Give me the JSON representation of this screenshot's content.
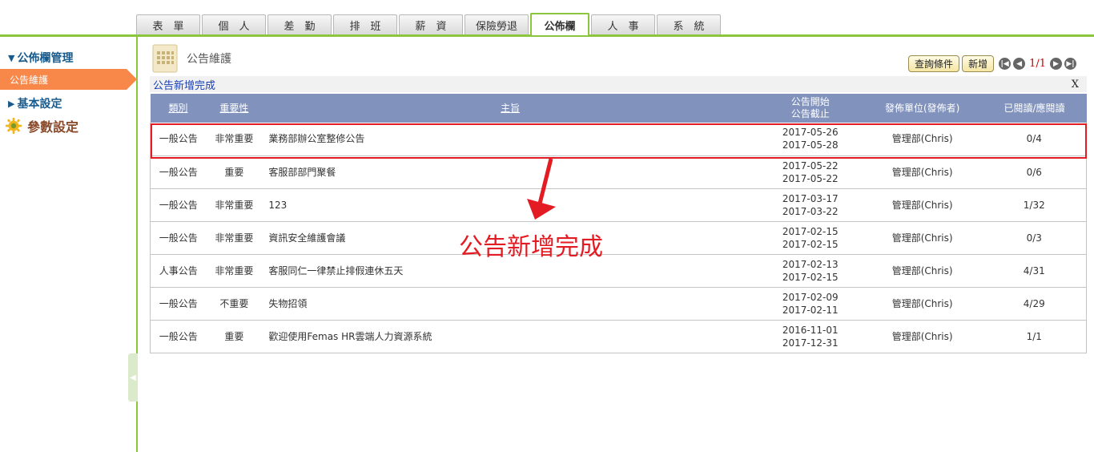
{
  "tabs": [
    {
      "label": "表　單",
      "width": 80
    },
    {
      "label": "個　人",
      "width": 80
    },
    {
      "label": "差　勤",
      "width": 80
    },
    {
      "label": "排　班",
      "width": 80
    },
    {
      "label": "薪　資",
      "width": 80
    },
    {
      "label": "保險勞退",
      "width": 80
    },
    {
      "label": "公佈欄",
      "width": 74,
      "active": true
    },
    {
      "label": "人　事",
      "width": 80
    },
    {
      "label": "系　統",
      "width": 80
    }
  ],
  "sidebar": {
    "section1": "公佈欄管理",
    "active_item": "公告維護",
    "section2": "基本設定",
    "param": "參數設定"
  },
  "page": {
    "title": "公告維護",
    "query_button": "查詢條件",
    "add_button": "新增",
    "page_indicator": "1/1",
    "message": "公告新增完成",
    "close": "X"
  },
  "table": {
    "headers": {
      "category": "類別",
      "importance": "重要性",
      "subject": "主旨",
      "date_start": "公告開始",
      "date_end": "公告截止",
      "department": "發佈單位(發佈者)",
      "read": "已閱讀/應閱讀"
    },
    "rows": [
      {
        "category": "一般公告",
        "importance": "非常重要",
        "subject": "業務部辦公室整修公告",
        "start": "2017-05-26",
        "end": "2017-05-28",
        "department": "管理部(Chris)",
        "read": "0/4"
      },
      {
        "category": "一般公告",
        "importance": "重要",
        "subject": "客服部部門聚餐",
        "start": "2017-05-22",
        "end": "2017-05-22",
        "department": "管理部(Chris)",
        "read": "0/6"
      },
      {
        "category": "一般公告",
        "importance": "非常重要",
        "subject": "123",
        "start": "2017-03-17",
        "end": "2017-03-22",
        "department": "管理部(Chris)",
        "read": "1/32"
      },
      {
        "category": "一般公告",
        "importance": "非常重要",
        "subject": "資訊安全維護會議",
        "start": "2017-02-15",
        "end": "2017-02-15",
        "department": "管理部(Chris)",
        "read": "0/3"
      },
      {
        "category": "人事公告",
        "importance": "非常重要",
        "subject": "客服同仁一律禁止排假連休五天",
        "start": "2017-02-13",
        "end": "2017-02-15",
        "department": "管理部(Chris)",
        "read": "4/31"
      },
      {
        "category": "一般公告",
        "importance": "不重要",
        "subject": "失物招領",
        "start": "2017-02-09",
        "end": "2017-02-11",
        "department": "管理部(Chris)",
        "read": "4/29"
      },
      {
        "category": "一般公告",
        "importance": "重要",
        "subject": "歡迎使用Femas HR雲端人力資源系統",
        "start": "2016-11-01",
        "end": "2017-12-31",
        "department": "管理部(Chris)",
        "read": "1/1"
      }
    ]
  },
  "annotation": {
    "text": "公告新增完成",
    "color": "#e31b23"
  },
  "colors": {
    "accent_green": "#8cc63f",
    "sidebar_active": "#f7884a",
    "table_header": "#8192bd"
  }
}
